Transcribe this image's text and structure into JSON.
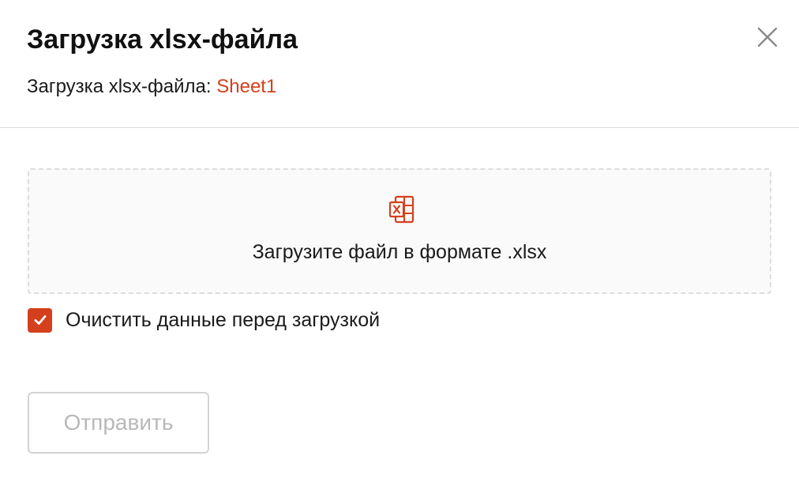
{
  "dialog": {
    "title": "Загрузка xlsx-файла",
    "subtitle_prefix": "Загрузка xlsx-файла: ",
    "sheet_name": "Sheet1",
    "close_icon": "close-icon"
  },
  "dropzone": {
    "icon": "excel-file-icon",
    "text": "Загрузите файл в формате .xlsx"
  },
  "clear_option": {
    "label": "Очистить данные перед загрузкой",
    "checked": true
  },
  "actions": {
    "submit_label": "Отправить",
    "submit_enabled": false
  },
  "colors": {
    "accent": "#d4401c",
    "border": "#d9d9d9",
    "disabled_text": "#b8b8b8"
  }
}
